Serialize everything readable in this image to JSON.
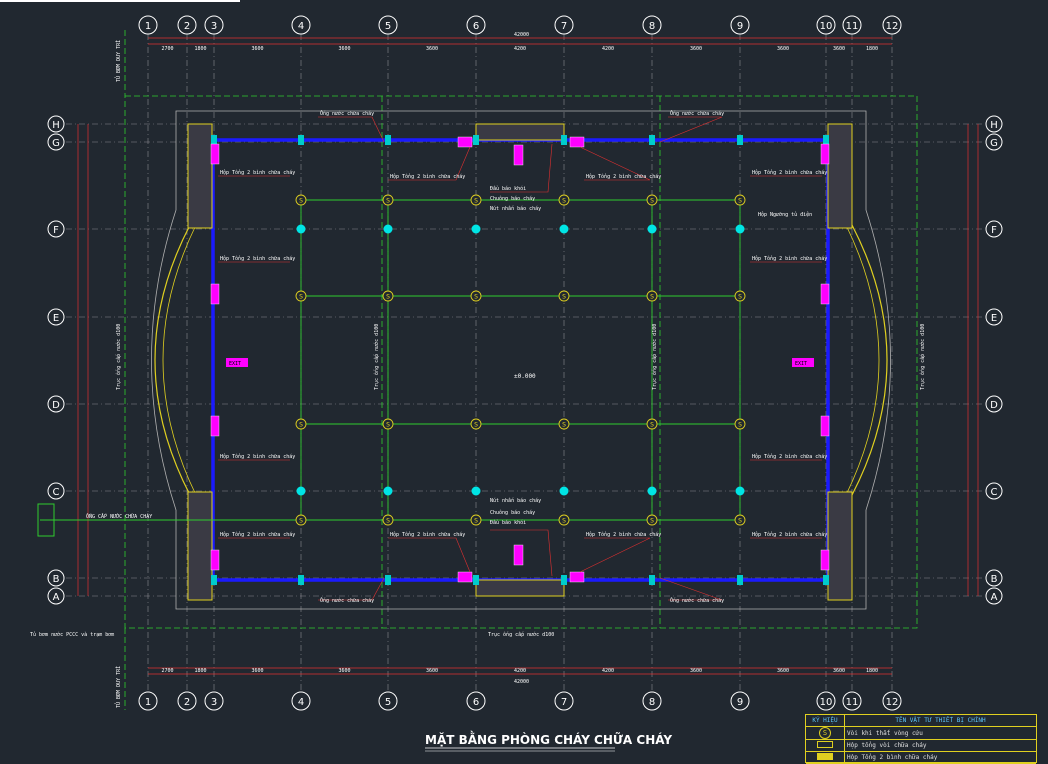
{
  "drawing": {
    "title": "MẶT BẰNG PHÒNG CHÁY CHỮA CHÁY",
    "top_grid_labels": [
      "1",
      "2",
      "3",
      "4",
      "5",
      "6",
      "7",
      "8",
      "9",
      "10",
      "11",
      "12"
    ],
    "bottom_grid_labels": [
      "1",
      "2",
      "3",
      "4",
      "5",
      "6",
      "7",
      "8",
      "9",
      "10",
      "11",
      "12"
    ],
    "left_row_labels": [
      "H",
      "G",
      "F",
      "E",
      "D",
      "C",
      "B",
      "A"
    ],
    "right_row_labels": [
      "H",
      "G",
      "F",
      "E",
      "D",
      "C",
      "B",
      "A"
    ],
    "top_dims": [
      "2700",
      "1800",
      "3600",
      "3600",
      "3600",
      "4200",
      "4200",
      "3600",
      "3600",
      "3600",
      "1800",
      "2700"
    ],
    "overall_dim": "42000",
    "level_mark": "±0.000",
    "side_note_left": "TỦ BƠM DUY TRÌ",
    "pipe_note": "ỐNG CẤP NƯỚC CHỮA CHÁY",
    "riser_note": "Trục ống cấp nước d100",
    "note_bottom_left": "Tủ bơm nước PCCC và trạm bơm",
    "label_box_left": "Hộp Tổng 2 bình chữa cháy",
    "label_sprinkler": "Ống nước chữa cháy",
    "label_alarm": "Nút nhấn báo cháy",
    "label_smoke": "Đầu báo khói",
    "label_bell": "Chuông báo cháy",
    "label_lamp": "Đèn Exit",
    "label_panel": "Hộp Ngưỡng tủ điện",
    "label_exit": "EXIT"
  },
  "legend": {
    "col1": "KÝ HIỆU",
    "col2": "TÊN VẬT TƯ THIẾT BỊ CHÍNH",
    "rows": [
      {
        "symbol": "S",
        "text": "Vòi khi thắt vòng cứu"
      },
      {
        "symbol": "box",
        "text": "Hộp tổng vòi chữa cháy"
      },
      {
        "symbol": "box2",
        "text": "Hộp Tổng 2 bình chữa cháy"
      }
    ]
  },
  "colors": {
    "background": "#212830",
    "wall_blue": "#1a1aff",
    "pipe_green": "#2ecc2e",
    "grid_dash": "#9a9aa0",
    "dim_red": "#e03030",
    "magenta": "#ff00ff",
    "cyan": "#00ffff",
    "yellow": "#e0d020"
  }
}
